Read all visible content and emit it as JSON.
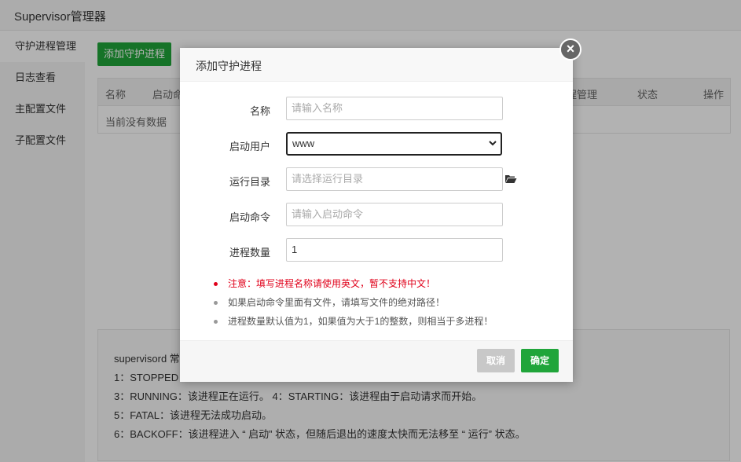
{
  "app": {
    "title": "Supervisor管理器"
  },
  "sidebar": {
    "items": [
      {
        "label": "守护进程管理"
      },
      {
        "label": "日志查看"
      },
      {
        "label": "主配置文件"
      },
      {
        "label": "子配置文件"
      }
    ]
  },
  "main": {
    "add_button": "添加守护进程",
    "table": {
      "headers": [
        "名称",
        "启动命",
        "程管理",
        "状态",
        "操作"
      ],
      "empty_text": "当前没有数据"
    },
    "legend": [
      "supervisord 常",
      "1：STOPPED：",
      "3：RUNNING：该进程正在运行。 4：STARTING：该进程由于启动请求而开始。",
      "5：FATAL：该进程无法成功启动。",
      "6：BACKOFF：该进程进入 “ 启动” 状态，但随后退出的速度太快而无法移至 “ 运行” 状态。"
    ]
  },
  "dialog": {
    "title": "添加守护进程",
    "fields": {
      "name": {
        "label": "名称",
        "placeholder": "请输入名称"
      },
      "user": {
        "label": "启动用户",
        "value": "www"
      },
      "dir": {
        "label": "运行目录",
        "placeholder": "请选择运行目录"
      },
      "command": {
        "label": "启动命令",
        "placeholder": "请输入启动命令"
      },
      "count": {
        "label": "进程数量",
        "value": "1"
      }
    },
    "notes": [
      "注意：填写进程名称请使用英文，暂不支持中文！",
      "如果启动命令里面有文件，请填写文件的绝对路径！",
      "进程数量默认值为1，如果值为大于1的整数，则相当于多进程！"
    ],
    "cancel_label": "取消",
    "ok_label": "确定"
  },
  "icons": {
    "close": "close-icon",
    "folder": "folder-open-icon",
    "chevron": "chevron-down-icon"
  },
  "colors": {
    "primary": "#20a53a",
    "warning": "#e0001a"
  }
}
